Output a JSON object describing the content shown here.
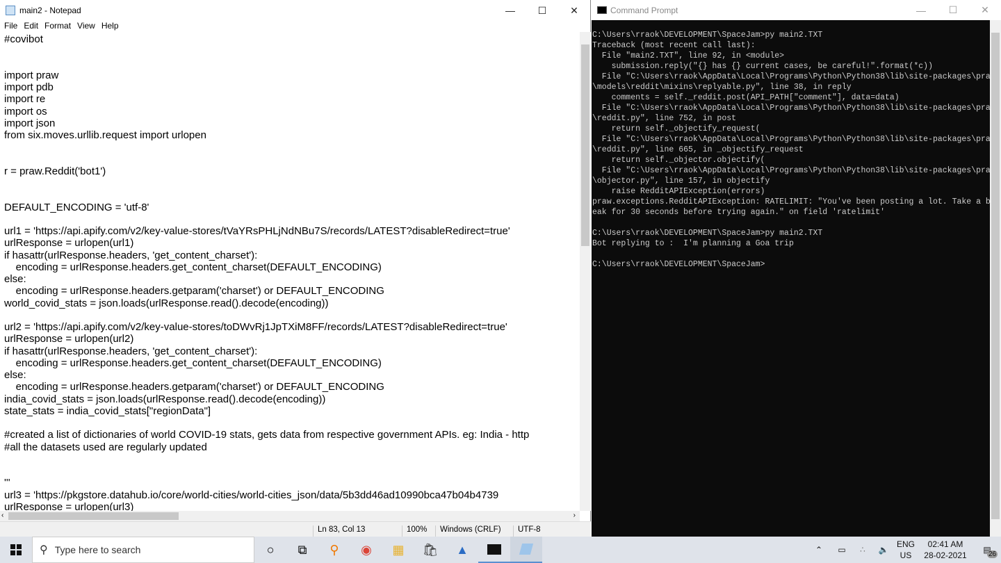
{
  "notepad": {
    "title": "main2 - Notepad",
    "menu": [
      "File",
      "Edit",
      "Format",
      "View",
      "Help"
    ],
    "lines": [
      "#covibot",
      "",
      "",
      "import praw",
      "import pdb",
      "import re",
      "import os",
      "import json",
      "from six.moves.urllib.request import urlopen",
      "",
      "",
      "r = praw.Reddit('bot1')",
      "",
      "",
      "DEFAULT_ENCODING = 'utf-8'",
      "",
      "url1 = 'https://api.apify.com/v2/key-value-stores/tVaYRsPHLjNdNBu7S/records/LATEST?disableRedirect=true'",
      "urlResponse = urlopen(url1)",
      "if hasattr(urlResponse.headers, 'get_content_charset'):",
      "    encoding = urlResponse.headers.get_content_charset(DEFAULT_ENCODING)",
      "else:",
      "    encoding = urlResponse.headers.getparam('charset') or DEFAULT_ENCODING",
      "world_covid_stats = json.loads(urlResponse.read().decode(encoding))",
      "",
      "url2 = 'https://api.apify.com/v2/key-value-stores/toDWvRj1JpTXiM8FF/records/LATEST?disableRedirect=true'",
      "urlResponse = urlopen(url2)",
      "if hasattr(urlResponse.headers, 'get_content_charset'):",
      "    encoding = urlResponse.headers.get_content_charset(DEFAULT_ENCODING)",
      "else:",
      "    encoding = urlResponse.headers.getparam('charset') or DEFAULT_ENCODING",
      "india_covid_stats = json.loads(urlResponse.read().decode(encoding))",
      "state_stats = india_covid_stats[\"regionData\"]",
      "",
      "#created a list of dictionaries of world COVID-19 stats, gets data from respective government APIs. eg: India - http",
      "#all the datasets used are regularly updated",
      "",
      "",
      "'''",
      "url3 = 'https://pkgstore.datahub.io/core/world-cities/world-cities_json/data/5b3dd46ad10990bca47b04b4739",
      "urlResponse = urlopen(url3)"
    ],
    "status": {
      "position": "Ln 83, Col 13",
      "zoom": "100%",
      "line_ending": "Windows (CRLF)",
      "encoding": "UTF-8"
    }
  },
  "cmd": {
    "title": "Command Prompt",
    "lines": [
      "C:\\Users\\rraok\\DEVELOPMENT\\SpaceJam>py main2.TXT",
      "Traceback (most recent call last):",
      "  File \"main2.TXT\", line 92, in <module>",
      "    submission.reply(\"{} has {} current cases, be careful!\".format(*c))",
      "  File \"C:\\Users\\rraok\\AppData\\Local\\Programs\\Python\\Python38\\lib\\site-packages\\praw",
      "\\models\\reddit\\mixins\\replyable.py\", line 38, in reply",
      "    comments = self._reddit.post(API_PATH[\"comment\"], data=data)",
      "  File \"C:\\Users\\rraok\\AppData\\Local\\Programs\\Python\\Python38\\lib\\site-packages\\praw",
      "\\reddit.py\", line 752, in post",
      "    return self._objectify_request(",
      "  File \"C:\\Users\\rraok\\AppData\\Local\\Programs\\Python\\Python38\\lib\\site-packages\\praw",
      "\\reddit.py\", line 665, in _objectify_request",
      "    return self._objector.objectify(",
      "  File \"C:\\Users\\rraok\\AppData\\Local\\Programs\\Python\\Python38\\lib\\site-packages\\praw",
      "\\objector.py\", line 157, in objectify",
      "    raise RedditAPIException(errors)",
      "praw.exceptions.RedditAPIException: RATELIMIT: \"You've been posting a lot. Take a br",
      "eak for 30 seconds before trying again.\" on field 'ratelimit'",
      "",
      "C:\\Users\\rraok\\DEVELOPMENT\\SpaceJam>py main2.TXT",
      "Bot replying to :  I'm planning a Goa trip",
      "",
      "C:\\Users\\rraok\\DEVELOPMENT\\SpaceJam>"
    ]
  },
  "taskbar": {
    "search_placeholder": "Type here to search",
    "apps": [
      "cortana-icon",
      "task-view-icon",
      "search-app-icon",
      "chrome-icon",
      "file-explorer-icon",
      "store-icon",
      "app-icon",
      "command-prompt-icon",
      "notepad-icon"
    ],
    "lang1": "ENG",
    "lang2": "US",
    "time": "02:41 AM",
    "date": "28-02-2021",
    "notifications": "26"
  }
}
